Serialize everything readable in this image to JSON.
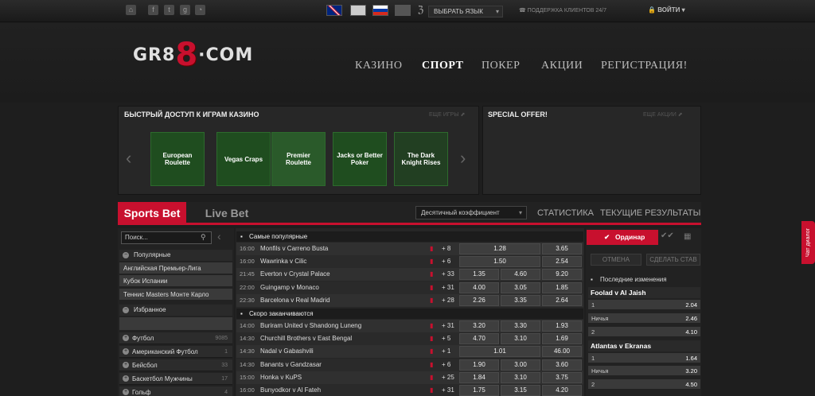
{
  "top": {
    "language_label": "ВЫБРАТЬ ЯЗЫК",
    "support_label": "ПОДДЕРЖКА КЛИЕНТОВ 24/7",
    "login_label": "ВОЙТИ"
  },
  "logo": {
    "pre": "GR8",
    "eight": "8",
    "post": "·COM"
  },
  "nav": [
    "КАЗИНО",
    "СПОРТ",
    "ПОКЕР",
    "АКЦИИ",
    "РЕГИСТРАЦИЯ!"
  ],
  "quick_access": {
    "title": "БЫСТРЫЙ ДОСТУП К ИГРАМ КАЗИНО",
    "more": "ЕЩЕ ИГРЫ",
    "games": [
      "European Roulette",
      "Vegas Craps",
      "Premier Roulette",
      "Jacks or Better Poker",
      "The Dark Knight Rises"
    ]
  },
  "special": {
    "title": "SPECIAL OFFER!",
    "more": "ЕЩЕ АКЦИИ"
  },
  "tabs": {
    "sports": "Sports Bet",
    "live": "Live Bet"
  },
  "odds_select": "Десятичный коэффициент",
  "links": {
    "stats": "СТАТИСТИКА",
    "results": "ТЕКУЩИЕ РЕЗУЛЬТАТЫ"
  },
  "left": {
    "search_placeholder": "Поиск...",
    "popular_head": "Популярные",
    "popular": [
      "Английская Премьер-Лига",
      "Кубок Испании",
      "Теннис Masters Монте Карло"
    ],
    "fav_head": "Избранное",
    "sports": [
      {
        "name": "Футбол",
        "count": "9085"
      },
      {
        "name": "Американский Футбол",
        "count": "1"
      },
      {
        "name": "Бейсбол",
        "count": "33"
      },
      {
        "name": "Баскетбол Мужчины",
        "count": "17"
      },
      {
        "name": "Гольф",
        "count": "4"
      }
    ]
  },
  "main": {
    "section1": "Самые популярные",
    "rows1": [
      {
        "time": "16:00",
        "match": "Monfils v Carreno Busta",
        "more": "+ 8",
        "o1": "1.28",
        "o2": "",
        "o3": "3.65"
      },
      {
        "time": "16:00",
        "match": "Wawrinka v Cilic",
        "more": "+ 6",
        "o1": "1.50",
        "o2": "",
        "o3": "2.54"
      },
      {
        "time": "21:45",
        "match": "Everton v Crystal Palace",
        "more": "+ 33",
        "o1": "1.35",
        "o2": "4.60",
        "o3": "9.20"
      },
      {
        "time": "22:00",
        "match": "Guingamp v Monaco",
        "more": "+ 31",
        "o1": "4.00",
        "o2": "3.05",
        "o3": "1.85"
      },
      {
        "time": "22:30",
        "match": "Barcelona v Real Madrid",
        "more": "+ 28",
        "o1": "2.26",
        "o2": "3.35",
        "o3": "2.64"
      }
    ],
    "section2": "Скоро заканчиваются",
    "rows2": [
      {
        "time": "14:00",
        "match": "Buriram United v Shandong Luneng",
        "more": "+ 31",
        "o1": "3.20",
        "o2": "3.30",
        "o3": "1.93"
      },
      {
        "time": "14:30",
        "match": "Churchill Brothers v East Bengal",
        "more": "+ 5",
        "o1": "4.70",
        "o2": "3.10",
        "o3": "1.69"
      },
      {
        "time": "14:30",
        "match": "Nadal v Gabashvili",
        "more": "+ 1",
        "o1": "1.01",
        "o2": "",
        "o3": "46.00"
      },
      {
        "time": "14:30",
        "match": "Banants v Gandzasar",
        "more": "+ 6",
        "o1": "1.90",
        "o2": "3.00",
        "o3": "3.60"
      },
      {
        "time": "15:00",
        "match": "Honka v KuPS",
        "more": "+ 25",
        "o1": "1.84",
        "o2": "3.10",
        "o3": "3.75"
      },
      {
        "time": "16:00",
        "match": "Bunyodkor v Al Fateh",
        "more": "+ 31",
        "o1": "1.75",
        "o2": "3.15",
        "o3": "4.20"
      }
    ]
  },
  "right": {
    "tab": "Ординар",
    "cancel": "ОТМЕНА",
    "place": "СДЕЛАТЬ СТАВ",
    "recent_head": "Последние изменения",
    "m1": "Foolad v Al Jaish",
    "m1rows": [
      {
        "l": "1",
        "v": "2.04"
      },
      {
        "l": "Ничья",
        "v": "2.46"
      },
      {
        "l": "2",
        "v": "4.10"
      }
    ],
    "m2": "Atlantas v Ekranas",
    "m2rows": [
      {
        "l": "1",
        "v": "1.64"
      },
      {
        "l": "Ничья",
        "v": "3.20"
      },
      {
        "l": "2",
        "v": "4.50"
      }
    ]
  },
  "side_tab": "Чат диалог"
}
